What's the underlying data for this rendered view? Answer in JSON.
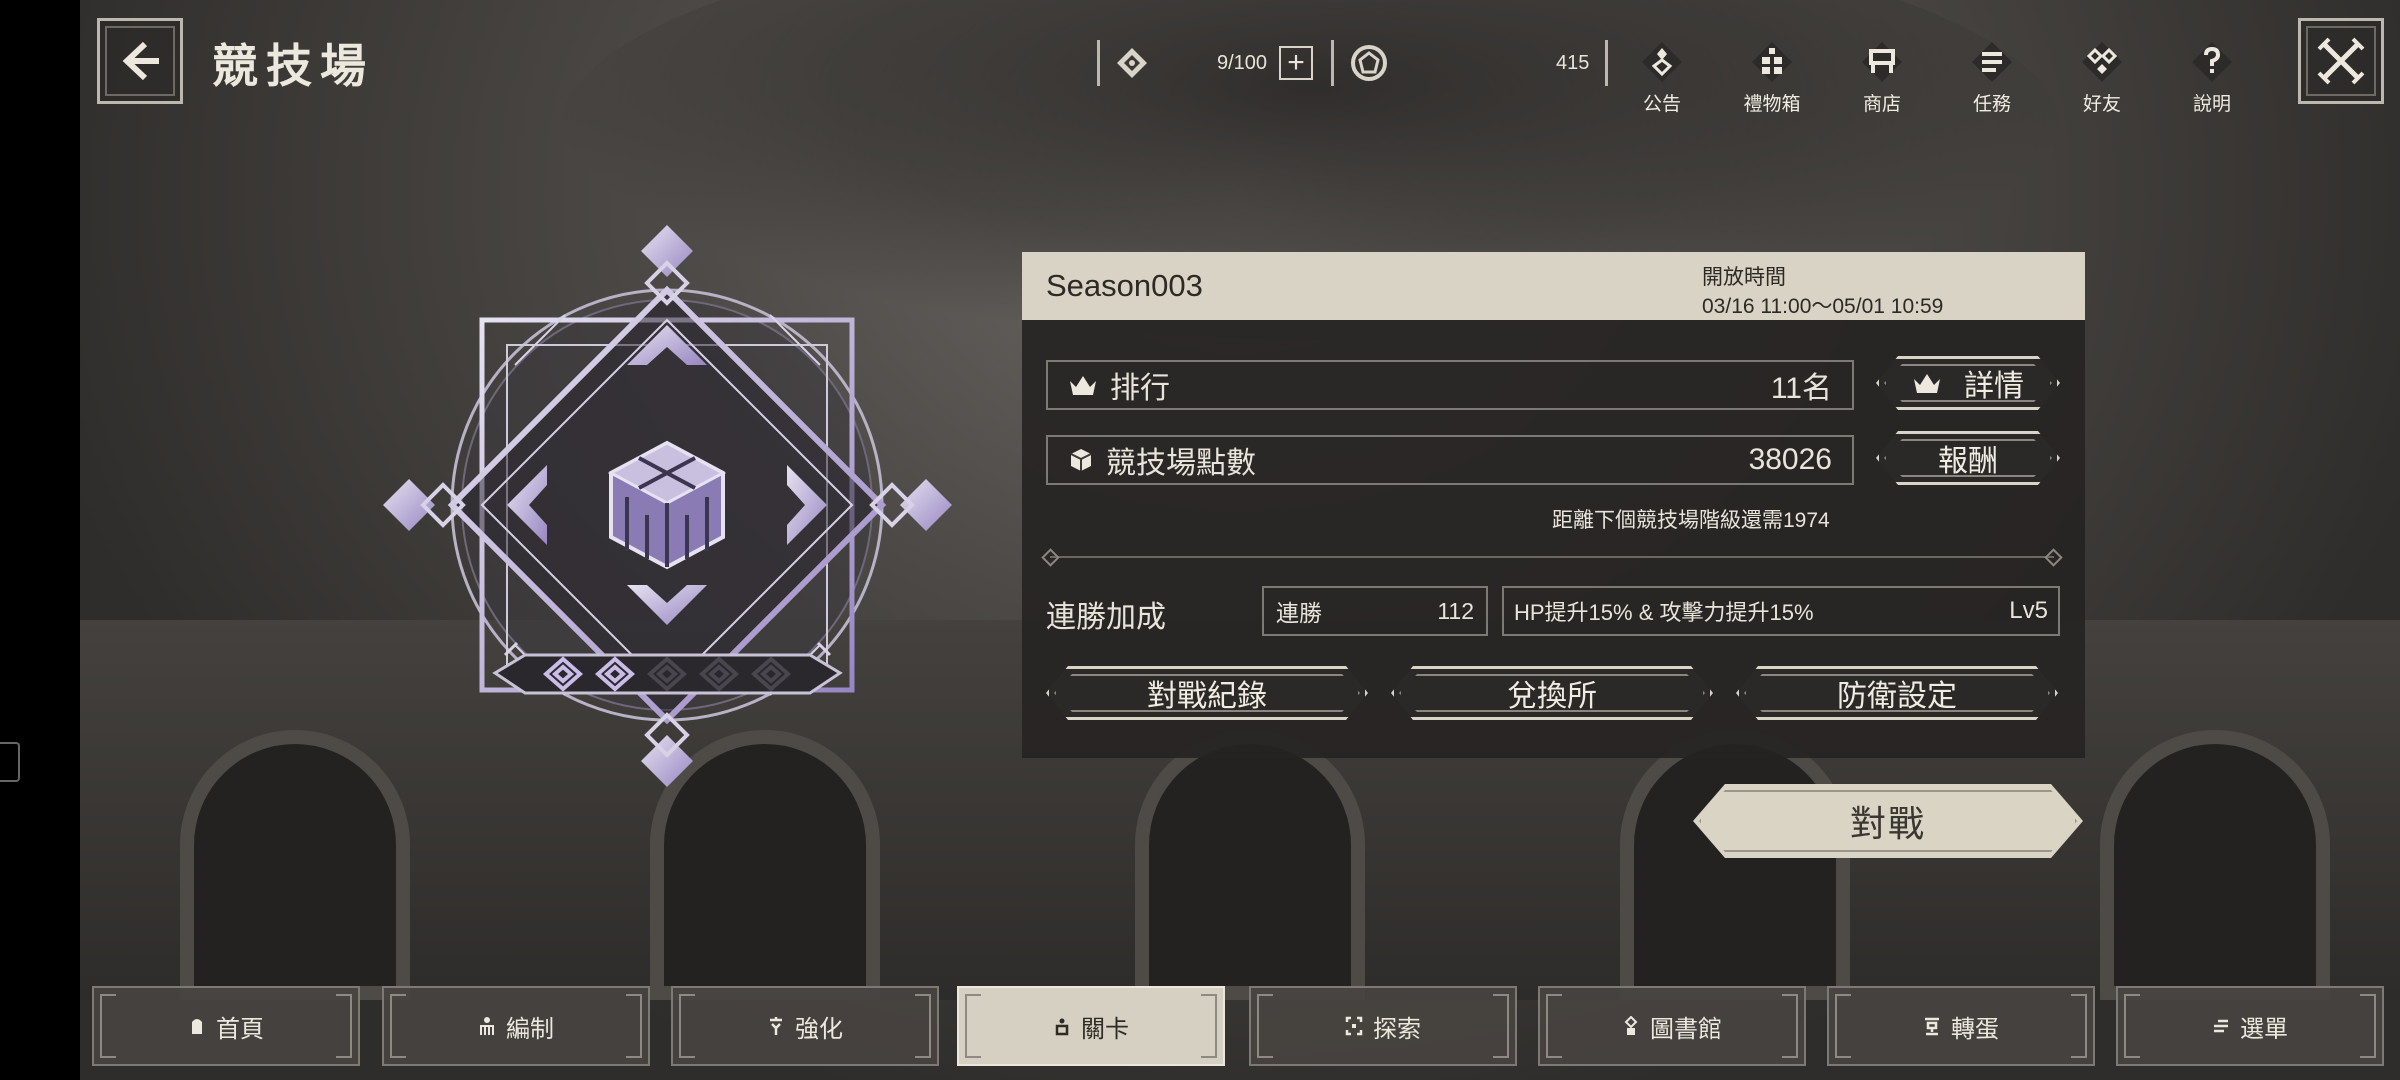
{
  "header": {
    "title": "競技場",
    "stamina": "9/100",
    "currency": "415",
    "icons": [
      {
        "icon": "announcement-icon",
        "label": "公告"
      },
      {
        "icon": "gift-box-icon",
        "label": "禮物箱"
      },
      {
        "icon": "shop-icon",
        "label": "商店"
      },
      {
        "icon": "missions-icon",
        "label": "任務"
      },
      {
        "icon": "friends-icon",
        "label": "好友"
      },
      {
        "icon": "help-icon",
        "label": "說明"
      }
    ]
  },
  "panel": {
    "season": "Season003",
    "open_label": "開放時間",
    "open_time": "03/16 11:00～05/01 10:59",
    "rank_label": "排行",
    "rank_value": "11名",
    "details_button": "詳情",
    "points_label": "競技場點數",
    "points_value": "38026",
    "reward_button": "報酬",
    "next_tier": "距離下個競技場階級還需1974",
    "streak_title": "連勝加成",
    "streak_label": "連勝",
    "streak_value": "112",
    "bonus_text": "HP提升15% & 攻擊力提升15%",
    "bonus_level": "Lv5",
    "record_button": "對戰紀錄",
    "exchange_button": "兌換所",
    "defense_button": "防衛設定"
  },
  "battle_button": "對戰",
  "rank_pips": {
    "filled": 2,
    "total": 5
  },
  "nav": [
    {
      "label": "首頁",
      "icon": "home-icon"
    },
    {
      "label": "編制",
      "icon": "formation-icon"
    },
    {
      "label": "強化",
      "icon": "enhance-icon"
    },
    {
      "label": "關卡",
      "icon": "stage-icon",
      "active": true
    },
    {
      "label": "探索",
      "icon": "explore-icon"
    },
    {
      "label": "圖書館",
      "icon": "library-icon"
    },
    {
      "label": "轉蛋",
      "icon": "gacha-icon"
    },
    {
      "label": "選單",
      "icon": "menu-icon"
    }
  ]
}
